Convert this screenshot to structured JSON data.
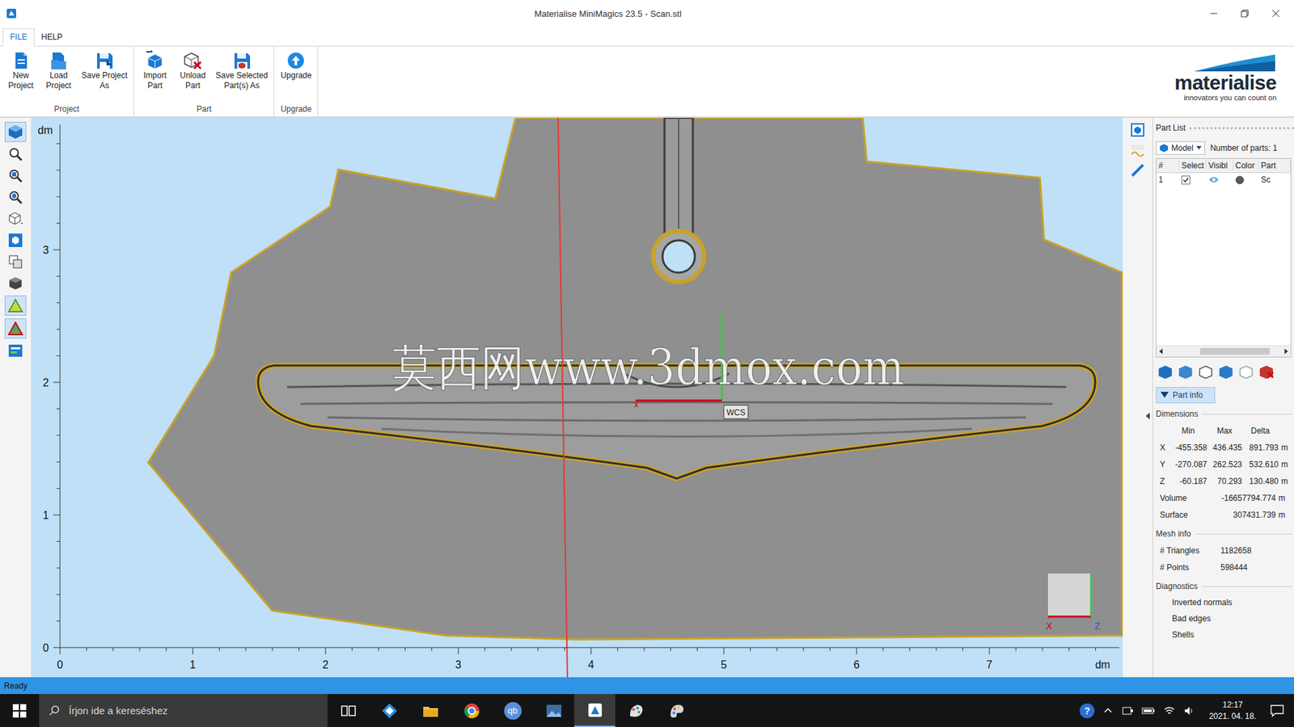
{
  "window": {
    "title": "Materialise MiniMagics 23.5 - Scan.stl"
  },
  "menu_tabs": [
    {
      "label": "FILE",
      "selected": true
    },
    {
      "label": "HELP",
      "selected": false
    }
  ],
  "ribbon": [
    {
      "group": "Project",
      "buttons": [
        {
          "kind": "new",
          "lines": [
            "New",
            "Project"
          ]
        },
        {
          "kind": "load",
          "lines": [
            "Load",
            "Project"
          ]
        },
        {
          "kind": "save",
          "lines": [
            "Save Project",
            "As"
          ]
        }
      ]
    },
    {
      "group": "Part",
      "buttons": [
        {
          "kind": "import",
          "lines": [
            "Import",
            "Part"
          ]
        },
        {
          "kind": "unload",
          "lines": [
            "Unload",
            "Part"
          ]
        },
        {
          "kind": "save-selected",
          "lines": [
            "Save Selected",
            "Part(s) As"
          ]
        }
      ]
    },
    {
      "group": "Upgrade",
      "buttons": [
        {
          "kind": "upgrade",
          "lines": [
            "Upgrade"
          ]
        }
      ]
    }
  ],
  "brand": {
    "name": "materialise",
    "tagline": "innovators you can count on"
  },
  "left_toolbar": [
    {
      "kind": "view",
      "selected": true
    },
    {
      "kind": "zoom",
      "selected": false
    },
    {
      "kind": "zoom-fit",
      "selected": false
    },
    {
      "kind": "zoom-part",
      "selected": false
    },
    {
      "kind": "view-cube",
      "selected": false
    },
    {
      "kind": "part-view",
      "selected": false
    },
    {
      "kind": "parts",
      "selected": false
    },
    {
      "kind": "shaded",
      "selected": false
    },
    {
      "kind": "triangles",
      "selected": true
    },
    {
      "kind": "triangles-edges",
      "selected": true
    },
    {
      "kind": "info",
      "selected": false
    }
  ],
  "viewport": {
    "y_unit": "dm",
    "x_unit": "dm",
    "y_ticks": [
      "3",
      "2",
      "1",
      "0"
    ],
    "x_ticks": [
      "0",
      "1",
      "2",
      "3",
      "4",
      "5",
      "6",
      "7"
    ],
    "origin_label": "WCS",
    "origin_x": "x",
    "cube_x": "X",
    "cube_z": "Z",
    "watermark": "莫西网www.3dmox.com"
  },
  "part_list": {
    "title": "Part List",
    "view": "Model",
    "count_label": "Number of parts: 1",
    "columns": [
      "#",
      "Select",
      "Visibl",
      "Color",
      "Part"
    ],
    "rows": [
      {
        "num": "1",
        "selected": true,
        "visible": true,
        "color": "#5a5a5a",
        "name": "Sc"
      }
    ]
  },
  "part_info": {
    "label": "Part info",
    "expanded": true,
    "dimensions": {
      "title": "Dimensions",
      "columns": [
        "Min",
        "Max",
        "Delta"
      ],
      "rows": [
        {
          "axis": "X",
          "min": "-455.358",
          "max": "436.435",
          "delta": "891.793",
          "unit": "m"
        },
        {
          "axis": "Y",
          "min": "-270.087",
          "max": "262.523",
          "delta": "532.610",
          "unit": "m"
        },
        {
          "axis": "Z",
          "min": "-60.187",
          "max": "70.293",
          "delta": "130.480",
          "unit": "m"
        }
      ]
    },
    "totals": [
      {
        "label": "Volume",
        "value": "-16657794.774",
        "unit": "m"
      },
      {
        "label": "Surface",
        "value": "307431.739",
        "unit": "m"
      }
    ],
    "mesh_info": {
      "title": "Mesh info",
      "rows": [
        {
          "label": "# Triangles",
          "value": "1182658"
        },
        {
          "label": "# Points",
          "value": "598444"
        }
      ]
    },
    "diagnostics": {
      "title": "Diagnostics",
      "items": [
        "Inverted normals",
        "Bad edges",
        "Shells"
      ]
    }
  },
  "status_bar": {
    "text": "Ready"
  },
  "taskbar": {
    "search_placeholder": "Írjon ide a kereséshez",
    "help": "?",
    "time": "12:17",
    "date": "2021. 04. 18.",
    "apps": [
      {
        "kind": "task-view",
        "active": false,
        "label": ""
      },
      {
        "kind": "people",
        "active": false,
        "label": ""
      },
      {
        "kind": "explorer",
        "active": false,
        "label": ""
      },
      {
        "kind": "chrome",
        "active": false,
        "label": ""
      },
      {
        "kind": "qbittorrent",
        "active": false,
        "label": "qb"
      },
      {
        "kind": "photos",
        "active": false,
        "label": ""
      },
      {
        "kind": "minimagics",
        "active": true,
        "label": ""
      },
      {
        "kind": "paint3d",
        "active": false,
        "label": ""
      },
      {
        "kind": "paint",
        "active": false,
        "label": ""
      }
    ]
  }
}
